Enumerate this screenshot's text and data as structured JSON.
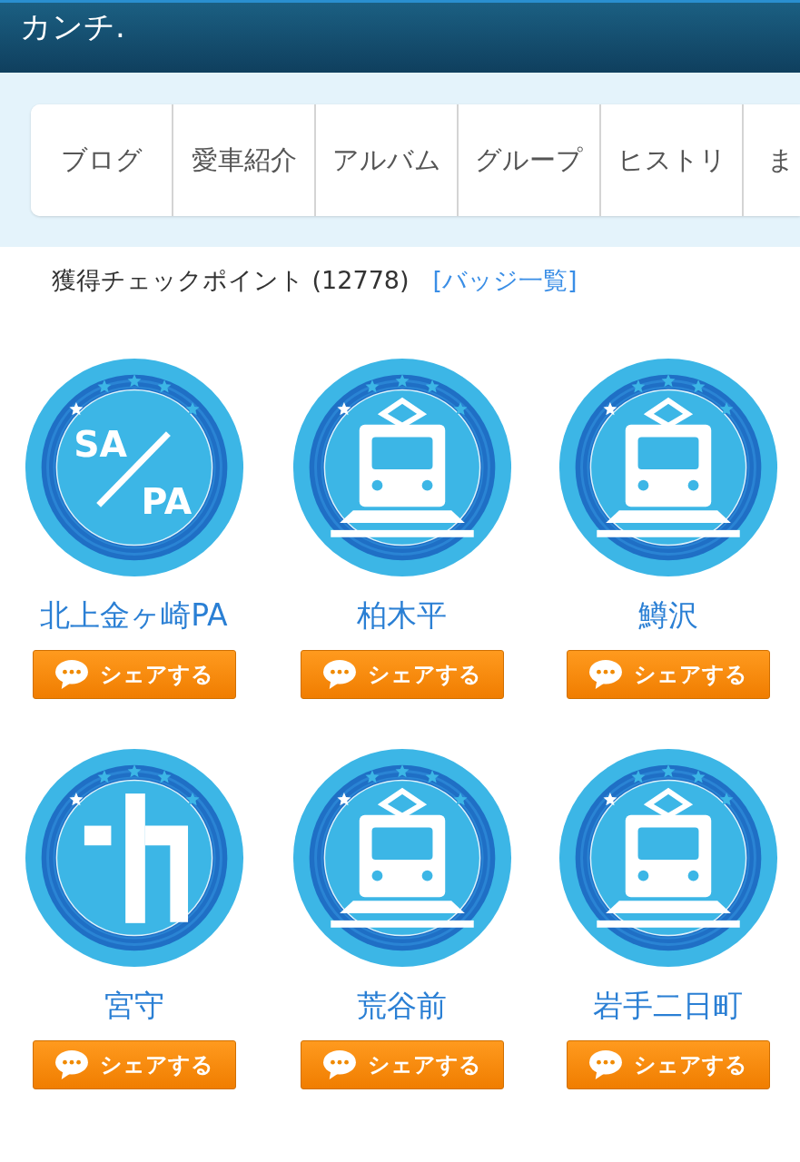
{
  "header": {
    "title": "カンチ."
  },
  "tabs": [
    {
      "label": "ブログ",
      "selected": false
    },
    {
      "label": "愛車紹介",
      "selected": false
    },
    {
      "label": "アルバム",
      "selected": false
    },
    {
      "label": "グループ",
      "selected": false
    },
    {
      "label": "ヒストリ",
      "selected": false
    },
    {
      "label": "ま",
      "selected": false
    }
  ],
  "checkpoints": {
    "heading": "獲得チェックポイント (12778)",
    "link": "[バッジ一覧]"
  },
  "badges": [
    {
      "kind": "sapa",
      "marks": [
        "SA",
        "PA"
      ],
      "name": "北上金ヶ崎PA",
      "button": "シェアする"
    },
    {
      "kind": "train",
      "name": "柏木平",
      "button": "シェアする"
    },
    {
      "kind": "train",
      "name": "鱒沢",
      "button": "シェアする"
    },
    {
      "kind": "junction",
      "name": "宮守",
      "button": "シェアする"
    },
    {
      "kind": "train",
      "name": "荒谷前",
      "button": "シェアする"
    },
    {
      "kind": "train",
      "name": "岩手二日町",
      "button": "シェアする"
    }
  ]
}
